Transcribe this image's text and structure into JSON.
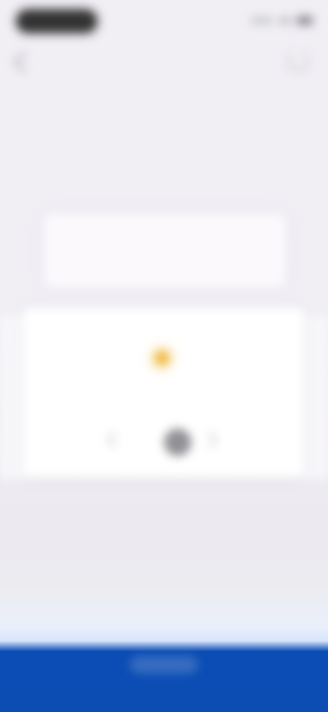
{
  "status_bar": {
    "icons": [
      "signal-icon",
      "wifi-icon",
      "battery-icon"
    ]
  },
  "header": {
    "title": "",
    "subtitle": ""
  },
  "info_card": {
    "caption": "",
    "heading": "",
    "body": ""
  },
  "main_card": {
    "title": "",
    "description": "",
    "controls": [
      "previous-control",
      "center-control",
      "next-control"
    ]
  },
  "bottom_bar": {
    "label": ""
  },
  "colors": {
    "background": "#f1eff4",
    "bottom_bar": "#0b4db3",
    "accent_sun": "#f0b93f"
  }
}
